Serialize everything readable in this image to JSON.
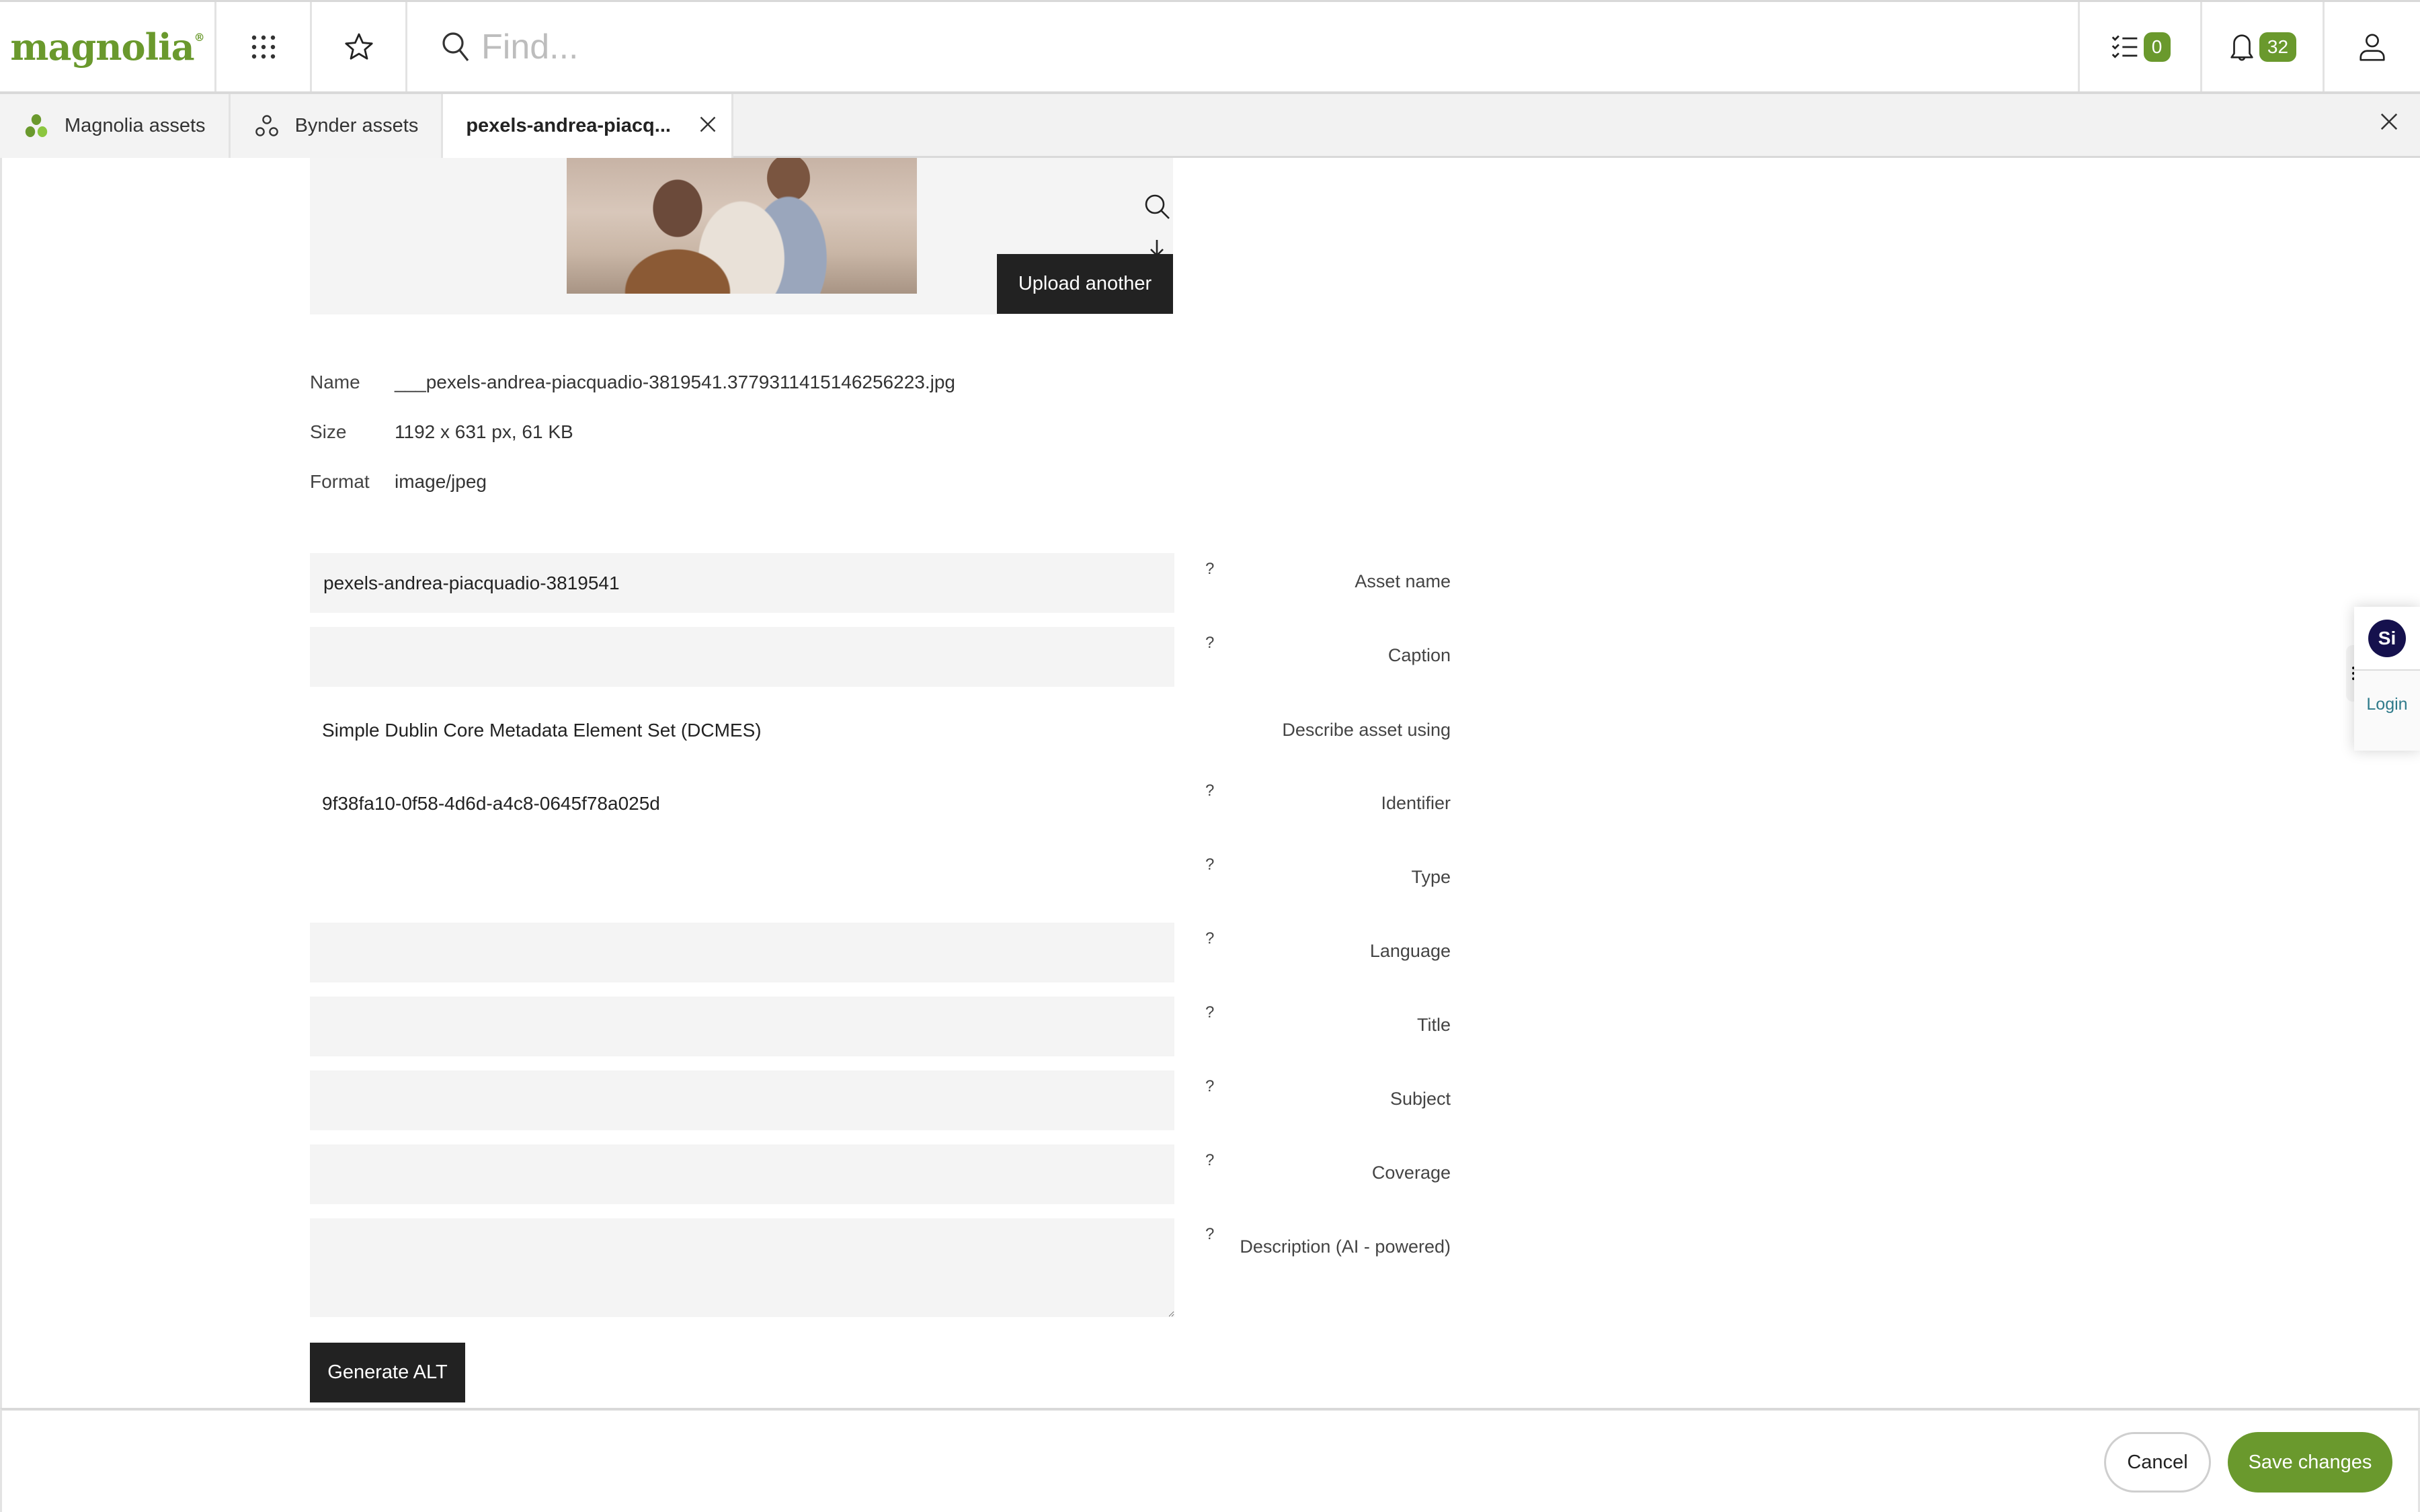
{
  "header": {
    "logo_text": "magnolia",
    "logo_mark": "®",
    "search_placeholder": "Find...",
    "tasks_count": "0",
    "notifications_count": "32",
    "icons": [
      "apps-grid-icon",
      "star-icon",
      "search-icon",
      "tasks-icon",
      "bell-icon",
      "user-icon"
    ]
  },
  "tabs": [
    {
      "label": "Magnolia assets",
      "icon": "magnolia-assets-icon",
      "active": false
    },
    {
      "label": "Bynder assets",
      "icon": "bynder-assets-icon",
      "active": false
    },
    {
      "label": "pexels-andrea-piacq...",
      "icon": "",
      "active": true,
      "closable": true
    }
  ],
  "preview": {
    "upload_label": "Upload another",
    "tools": [
      "zoom-icon",
      "download-icon"
    ]
  },
  "file_info": [
    {
      "key": "Name",
      "value": "___pexels-andrea-piacquadio-3819541.3779311415146256223.jpg"
    },
    {
      "key": "Size",
      "value": "1192 x 631 px, 61 KB"
    },
    {
      "key": "Format",
      "value": "image/jpeg"
    }
  ],
  "form": {
    "asset_name": {
      "label": "Asset name",
      "value": "pexels-andrea-piacquadio-3819541"
    },
    "caption": {
      "label": "Caption",
      "value": ""
    },
    "describe_using": {
      "label": "Describe asset using",
      "value": "Simple Dublin Core Metadata Element Set (DCMES)"
    },
    "identifier": {
      "label": "Identifier",
      "value": "9f38fa10-0f58-4d6d-a4c8-0645f78a025d"
    },
    "type": {
      "label": "Type",
      "value": ""
    },
    "language": {
      "label": "Language",
      "value": ""
    },
    "title": {
      "label": "Title",
      "value": ""
    },
    "subject": {
      "label": "Subject",
      "value": ""
    },
    "coverage": {
      "label": "Coverage",
      "value": ""
    },
    "description": {
      "label": "Description (AI - powered)",
      "value": ""
    },
    "help_glyph": "?",
    "generate_alt_label": "Generate ALT"
  },
  "footer": {
    "cancel_label": "Cancel",
    "save_label": "Save changes"
  },
  "side_widget": {
    "avatar_initials": "Si",
    "login_label": "Login"
  },
  "colors": {
    "brand_green": "#6a992d",
    "dark_button": "#222222",
    "avatar_navy": "#15114d",
    "login_link": "#2e7a8a"
  }
}
